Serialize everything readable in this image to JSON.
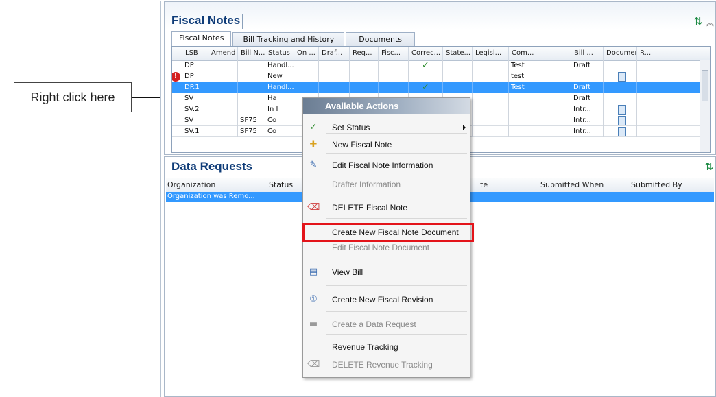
{
  "callout": {
    "text": "Right click here"
  },
  "fiscal_notes": {
    "title": "Fiscal Notes",
    "tabs": [
      "Fiscal Notes",
      "Bill Tracking and History",
      "Documents"
    ],
    "columns": [
      "LSB",
      "Amend",
      "Bill N...",
      "Status",
      "On ...",
      "Draf...",
      "Req...",
      "Fisc...",
      "Correc...",
      "State...",
      "Legisl...",
      "Com...",
      "",
      "Bill ...",
      "Document",
      "R..."
    ],
    "rows": [
      {
        "lsb": "DP",
        "bill": "",
        "status": "Handl...",
        "com": "Test",
        "bill2": "Draft",
        "check": true,
        "doc": false,
        "alert": false,
        "selected": false
      },
      {
        "lsb": "DP",
        "bill": "",
        "status": "New",
        "com": "test",
        "bill2": "",
        "check": false,
        "doc": true,
        "alert": true,
        "selected": false
      },
      {
        "lsb": "DP.1",
        "bill": "",
        "status": "Handl...",
        "com": "Test",
        "bill2": "Draft",
        "check": true,
        "doc": false,
        "alert": false,
        "selected": true
      },
      {
        "lsb": "SV",
        "bill": "",
        "status": "Ha",
        "com": "",
        "bill2": "Draft",
        "check": false,
        "doc": false,
        "alert": false,
        "selected": false
      },
      {
        "lsb": "SV.2",
        "bill": "",
        "status": "In I",
        "com": "",
        "bill2": "Intr...",
        "check": false,
        "doc": true,
        "alert": false,
        "selected": false
      },
      {
        "lsb": "SV",
        "bill": "SF75",
        "status": "Co",
        "com": "",
        "bill2": "Intr...",
        "check": false,
        "doc": true,
        "alert": false,
        "selected": false
      },
      {
        "lsb": "SV.1",
        "bill": "SF75",
        "status": "Co",
        "com": "",
        "bill2": "Intr...",
        "check": false,
        "doc": true,
        "alert": false,
        "selected": false
      }
    ]
  },
  "data_requests": {
    "title": "Data Requests",
    "columns": [
      "Organization",
      "Status",
      "te",
      "Submitted When",
      "Submitted By"
    ],
    "row": "Organization was Remo..."
  },
  "context_menu": {
    "header": "Available Actions",
    "items": [
      {
        "label": "Set Status",
        "icon": "check-icon",
        "disabled": false,
        "submenu": true
      },
      {
        "label": "New Fiscal Note",
        "icon": "new-note-icon",
        "disabled": false
      },
      {
        "label": "Edit Fiscal Note Information",
        "icon": "edit-icon",
        "disabled": false
      },
      {
        "label": "Drafter Information",
        "icon": "",
        "disabled": true
      },
      {
        "label": "DELETE Fiscal Note",
        "icon": "eraser-icon",
        "disabled": false
      },
      {
        "label": "Create New Fiscal Note Document",
        "icon": "",
        "disabled": false
      },
      {
        "label": "Edit Fiscal Note Document",
        "icon": "",
        "disabled": true
      },
      {
        "label": "View Bill",
        "icon": "view-bill-icon",
        "disabled": false
      },
      {
        "label": "Create New Fiscal Revision",
        "icon": "revision-icon",
        "disabled": false
      },
      {
        "label": "Create a Data Request",
        "icon": "data-request-icon",
        "disabled": true
      },
      {
        "label": "Revenue Tracking",
        "icon": "",
        "disabled": false
      },
      {
        "label": "DELETE Revenue Tracking",
        "icon": "eraser-icon",
        "disabled": true
      }
    ]
  },
  "colors": {
    "selection": "#3399ff",
    "title": "#0f3c78",
    "highlight_box": "#e3141a"
  }
}
